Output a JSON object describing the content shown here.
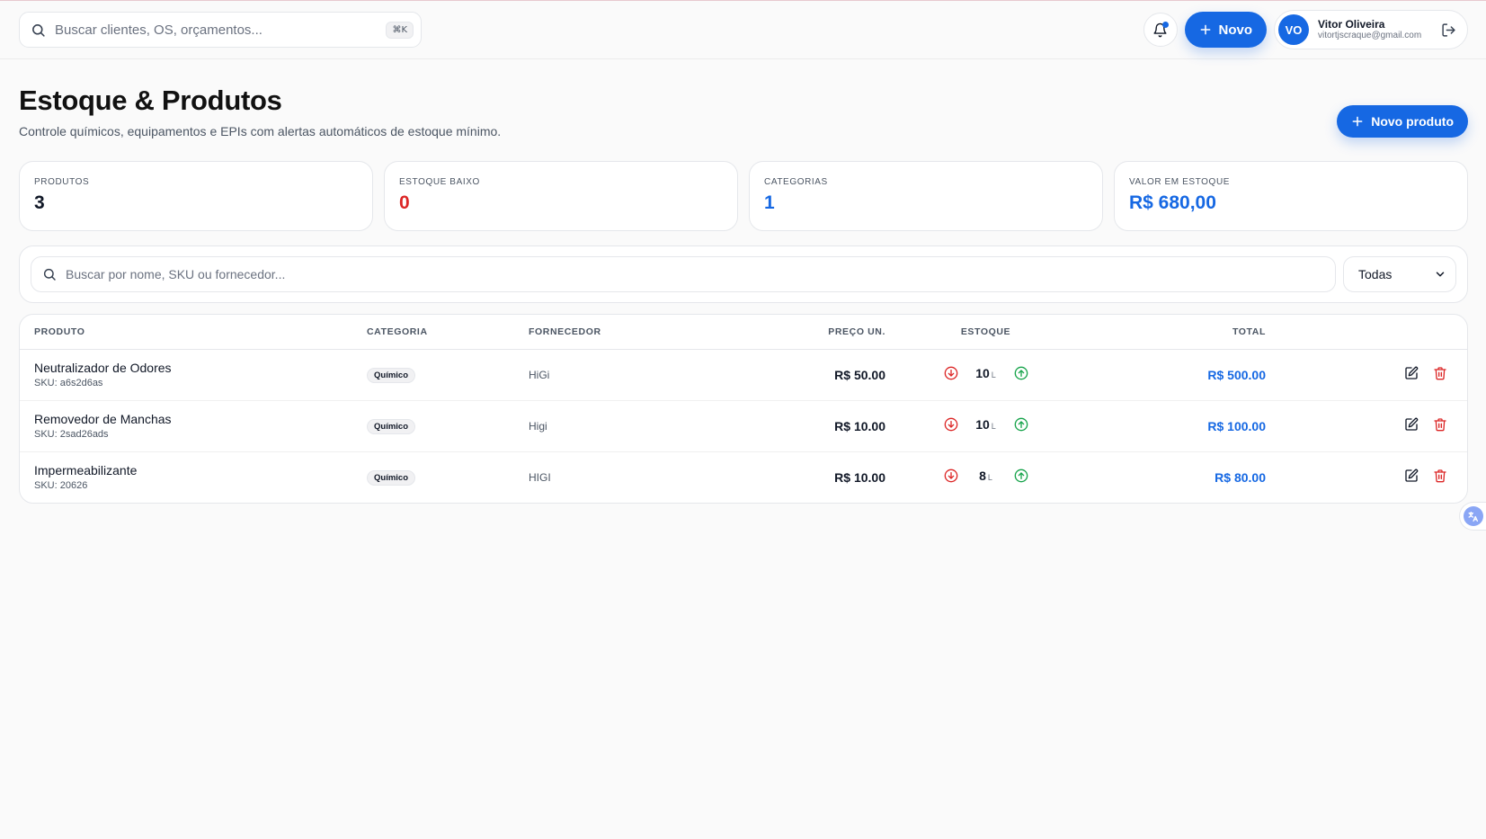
{
  "topbar": {
    "search_placeholder": "Buscar clientes, OS, orçamentos...",
    "search_shortcut": "⌘K",
    "new_label": "Novo",
    "user": {
      "initials": "VO",
      "name": "Vitor Oliveira",
      "email": "vitortjscraque@gmail.com"
    }
  },
  "page": {
    "title": "Estoque & Produtos",
    "subtitle": "Controle químicos, equipamentos e EPIs com alertas automáticos de estoque mínimo.",
    "new_product_label": "Novo produto"
  },
  "stats": [
    {
      "label": "PRODUTOS",
      "value": "3",
      "color": "#111827"
    },
    {
      "label": "ESTOQUE BAIXO",
      "value": "0",
      "color": "#dc2626"
    },
    {
      "label": "CATEGORIAS",
      "value": "1",
      "color": "#1668e3"
    },
    {
      "label": "VALOR EM ESTOQUE",
      "value": "R$ 680,00",
      "color": "#1668e3"
    }
  ],
  "filters": {
    "search_placeholder": "Buscar por nome, SKU ou fornecedor...",
    "category_selected": "Todas"
  },
  "table": {
    "headers": {
      "product": "PRODUTO",
      "category": "CATEGORIA",
      "supplier": "FORNECEDOR",
      "price": "PREÇO UN.",
      "stock": "ESTOQUE",
      "total": "TOTAL"
    },
    "rows": [
      {
        "name": "Neutralizador de Odores",
        "sku": "SKU: a6s2d6as",
        "category": "Químico",
        "supplier": "HiGi",
        "price": "R$ 50.00",
        "stock": "10",
        "unit": "L",
        "total": "R$ 500.00"
      },
      {
        "name": "Removedor de Manchas",
        "sku": "SKU: 2sad26ads",
        "category": "Químico",
        "supplier": "Higi",
        "price": "R$ 10.00",
        "stock": "10",
        "unit": "L",
        "total": "R$ 100.00"
      },
      {
        "name": "Impermeabilizante",
        "sku": "SKU: 20626",
        "category": "Químico",
        "supplier": "HIGI",
        "price": "R$ 10.00",
        "stock": "8",
        "unit": "L",
        "total": "R$ 80.00"
      }
    ]
  },
  "colors": {
    "accent": "#1668e3",
    "danger": "#dc2626",
    "success": "#16a34a"
  }
}
